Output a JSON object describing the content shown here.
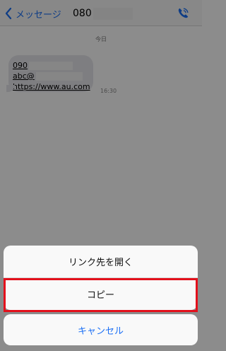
{
  "nav": {
    "back_label": "メッセージ",
    "contact_prefix": "080"
  },
  "conversation": {
    "date_label": "今日",
    "message": {
      "line1": "090",
      "line2": "abc@",
      "line3": "https://www.au.com",
      "time": "16:30"
    }
  },
  "action_sheet": {
    "open_link_label": "リンク先を開く",
    "copy_label": "コピー",
    "cancel_label": "キャンセル"
  },
  "colors": {
    "accent": "#1b6ff5",
    "highlight": "#e3101c"
  },
  "icons": {
    "back": "chevron-left-icon",
    "call": "phone-icon"
  }
}
